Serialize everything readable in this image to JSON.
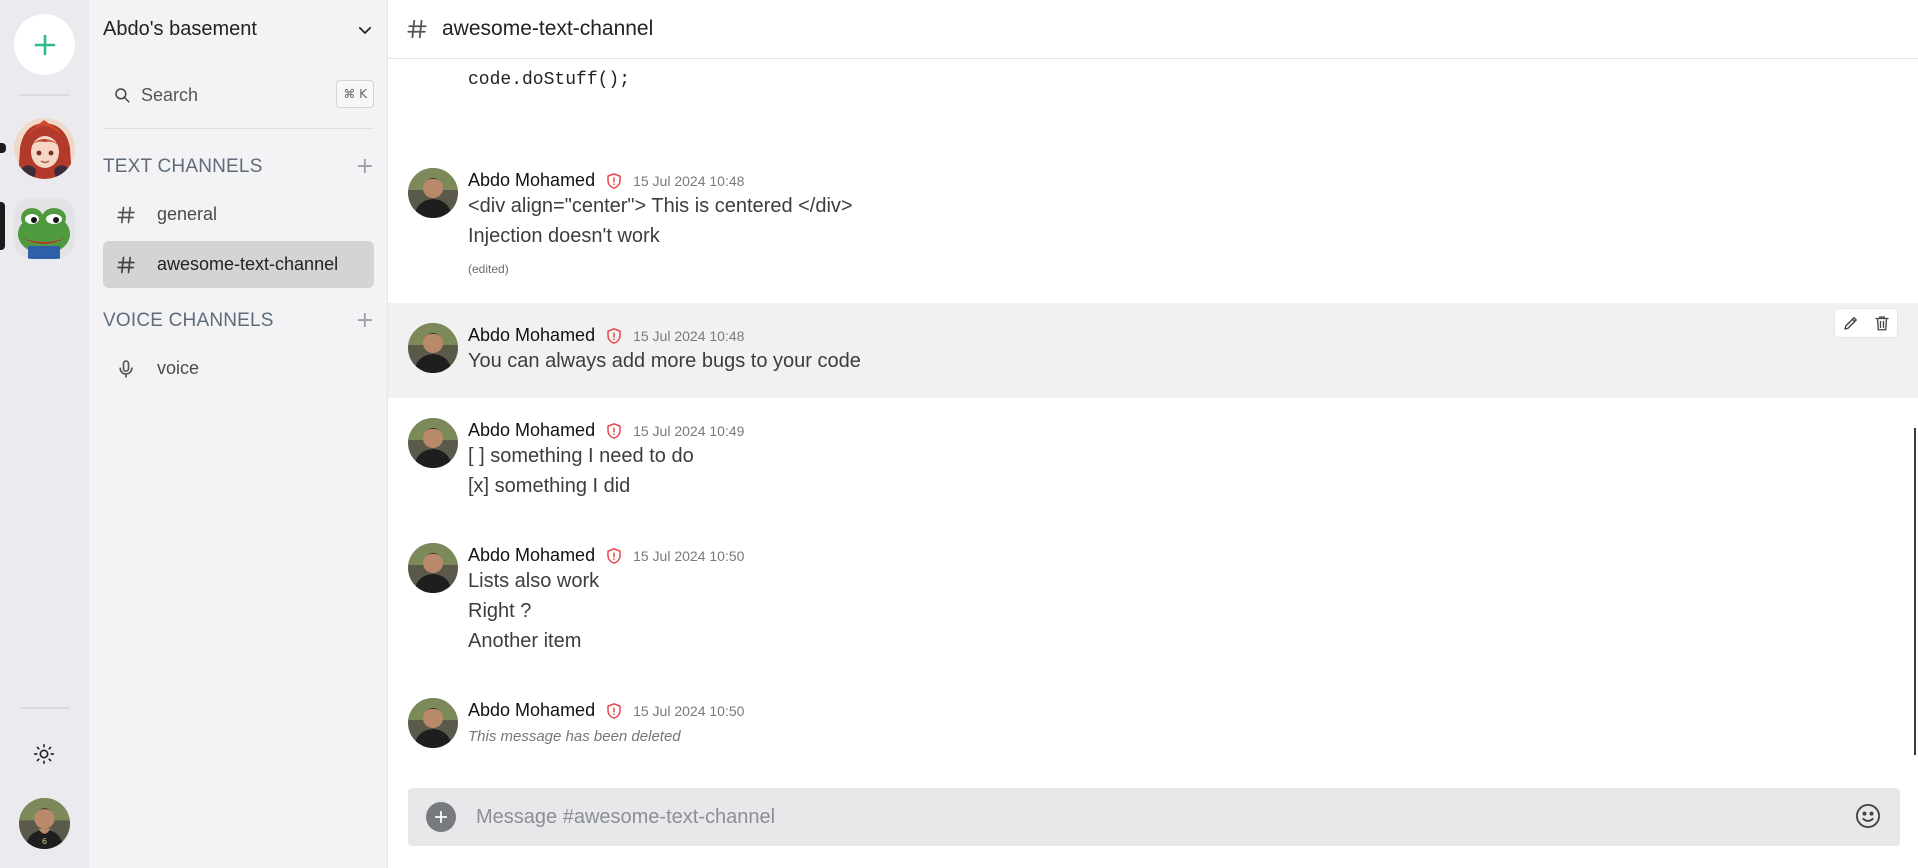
{
  "rail": {
    "add_icon": "plus-icon",
    "servers": [
      {
        "name": "anime-server-icon",
        "active": false
      },
      {
        "name": "frog-server-icon",
        "active": true
      }
    ],
    "theme_icon": "sun-icon",
    "accent_color": "#2fb989"
  },
  "sidebar": {
    "server_name": "Abdo's basement",
    "search": {
      "label": "Search",
      "shortcut": "⌘ K"
    },
    "text_section": {
      "title": "TEXT CHANNELS",
      "channels": [
        {
          "name": "general",
          "icon": "hash-icon",
          "active": false
        },
        {
          "name": "awesome-text-channel",
          "icon": "hash-icon",
          "active": true
        }
      ]
    },
    "voice_section": {
      "title": "VOICE CHANNELS",
      "channels": [
        {
          "name": "voice",
          "icon": "microphone-icon",
          "active": false
        }
      ]
    }
  },
  "channel": {
    "title": "awesome-text-channel"
  },
  "code_snippet": "code.doStuff();",
  "messages": [
    {
      "author": "Abdo Mohamed",
      "timestamp": "15 Jul 2024 10:48",
      "lines": [
        "<div align=\"center\"> This is centered </div>",
        "Injection doesn't work"
      ],
      "edited": "(edited)"
    },
    {
      "author": "Abdo Mohamed",
      "timestamp": "15 Jul 2024 10:48",
      "lines": [
        "You can always add more bugs to your code"
      ]
    },
    {
      "author": "Abdo Mohamed",
      "timestamp": "15 Jul 2024 10:49",
      "lines": [
        "[ ] something I need to do",
        "[x] something I did"
      ]
    },
    {
      "author": "Abdo Mohamed",
      "timestamp": "15 Jul 2024 10:50",
      "lines": [
        "Lists also work",
        "Right ?",
        "Another item"
      ]
    },
    {
      "author": "Abdo Mohamed",
      "timestamp": "15 Jul 2024 10:50",
      "deleted_text": "This message has been deleted"
    }
  ],
  "composer": {
    "placeholder": "Message #awesome-text-channel"
  },
  "colors": {
    "shield": "#e5484d",
    "active_channel_bg": "#d4d4d7"
  }
}
